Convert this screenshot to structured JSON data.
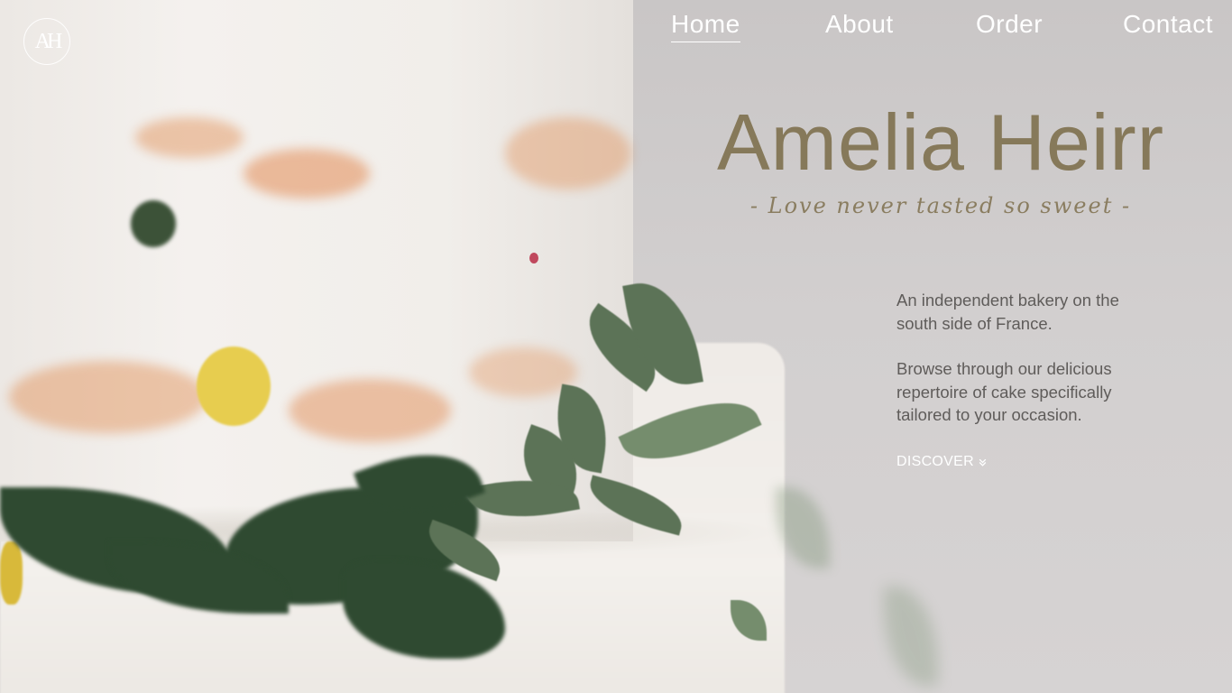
{
  "logo": {
    "text": "AH"
  },
  "nav": {
    "items": [
      {
        "label": "Home",
        "active": true
      },
      {
        "label": "About",
        "active": false
      },
      {
        "label": "Order",
        "active": false
      },
      {
        "label": "Contact",
        "active": false
      }
    ]
  },
  "hero": {
    "title": "Amelia Heirr",
    "tagline": "- Love never tasted so sweet -",
    "paragraph1": "An independent bakery on the south side of France.",
    "paragraph2": "Browse through our delicious repertoire of cake specifically tailored to your occasion.",
    "cta": "DISCOVER",
    "cta_icon": "double-chevron-down-icon"
  },
  "colors": {
    "accent": "#86795a",
    "body_text": "#5f5c5a",
    "nav_text": "#ffffff",
    "background": "#cfcccb"
  }
}
